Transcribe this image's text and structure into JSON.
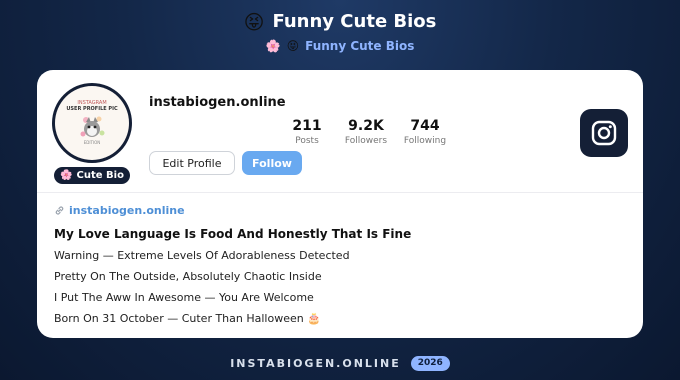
{
  "header": {
    "title_emoji": "😝",
    "title": "Funny Cute Bios",
    "subtitle_emojis": [
      "🌸",
      "😝"
    ],
    "subtitle": "Funny Cute Bios"
  },
  "profile": {
    "avatar_text": [
      "INSTAGRAM",
      "USER PROFILE PIC",
      "EDITION"
    ],
    "badge_emoji": "🌸",
    "badge_label": "Cute Bio",
    "username": "instabiogen.online",
    "stats": [
      {
        "value": "211",
        "label": "Posts"
      },
      {
        "value": "9.2K",
        "label": "Followers"
      },
      {
        "value": "744",
        "label": "Following"
      }
    ],
    "edit_label": "Edit Profile",
    "follow_label": "Follow",
    "instagram_icon": "instagram-icon"
  },
  "bio": {
    "link_icon": "link-icon",
    "link": "instabiogen.online",
    "headline": "My Love Language Is Food And Honestly That Is Fine",
    "lines": [
      "Warning — Extreme Levels Of Adorableness Detected",
      "Pretty On The Outside, Absolutely Chaotic Inside",
      "I Put The Aww In Awesome — You Are Welcome",
      "Born On 31 October — Cuter Than Halloween"
    ],
    "last_emoji": "🎂"
  },
  "footer": {
    "site": "INSTABIOGEN.ONLINE",
    "year": "2026"
  },
  "colors": {
    "accent": "#69a9f0",
    "dark": "#141f36",
    "link": "#4e8fd6",
    "subtitle": "#8fb4ff"
  }
}
